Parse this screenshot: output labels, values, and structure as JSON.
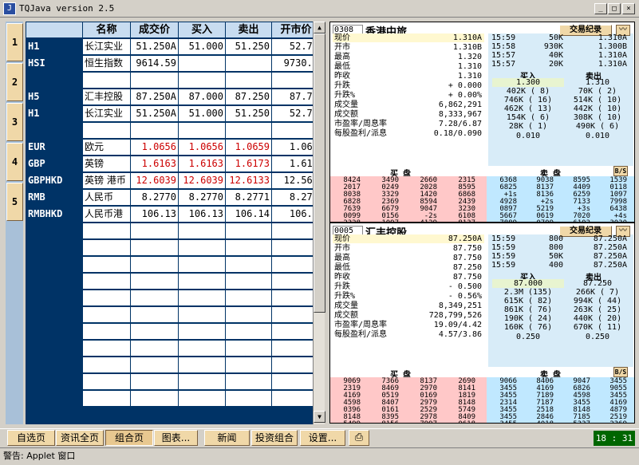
{
  "window": {
    "title": "TQJava version 2.5",
    "icon": "java-cup-icon"
  },
  "side_tabs": [
    "1",
    "2",
    "3",
    "4",
    "5"
  ],
  "grid": {
    "headers": [
      "",
      "名称",
      "成交价",
      "买入",
      "卖出",
      "开市价"
    ],
    "rows": [
      {
        "code": "H1",
        "name": "长江实业",
        "last": "51.250A",
        "bid": "51.000",
        "ask": "51.250",
        "open": "52.75",
        "red": false
      },
      {
        "code": "HSI",
        "name": "恒生指数",
        "last": "9614.59",
        "bid": "",
        "ask": "",
        "open": "9730.5",
        "red": false
      },
      {
        "code": "",
        "name": "",
        "last": "",
        "bid": "",
        "ask": "",
        "open": "",
        "red": false
      },
      {
        "code": "H5",
        "name": "汇丰控股",
        "last": "87.250A",
        "bid": "87.000",
        "ask": "87.250",
        "open": "87.75",
        "red": false
      },
      {
        "code": "H1",
        "name": "长江实业",
        "last": "51.250A",
        "bid": "51.000",
        "ask": "51.250",
        "open": "52.75",
        "red": false
      },
      {
        "code": "",
        "name": "",
        "last": "",
        "bid": "",
        "ask": "",
        "open": "",
        "red": false
      },
      {
        "code": "EUR",
        "name": "欧元",
        "last": "1.0656",
        "bid": "1.0656",
        "ask": "1.0659",
        "open": "1.061",
        "red": true
      },
      {
        "code": "GBP",
        "name": "英镑",
        "last": "1.6163",
        "bid": "1.6163",
        "ask": "1.6173",
        "open": "1.611",
        "red": true
      },
      {
        "code": "GBPHKD",
        "name": "英镑 港币",
        "last": "12.6039",
        "bid": "12.6039",
        "ask": "12.6133",
        "open": "12.561",
        "red": true
      },
      {
        "code": "RMB",
        "name": "人民币",
        "last": "8.2770",
        "bid": "8.2770",
        "ask": "8.2771",
        "open": "8.276",
        "red": false
      },
      {
        "code": "RMBHKD",
        "name": "人民币港",
        "last": "106.13",
        "bid": "106.13",
        "ask": "106.14",
        "open": "106.1",
        "red": false
      }
    ],
    "empty_rows": 11
  },
  "panels": [
    {
      "code": "0308",
      "name": "香港中旅",
      "deal_button": "交易纪录",
      "chart_button": "〰",
      "fields": [
        {
          "label": "现价",
          "value": "1.310A"
        },
        {
          "label": "开市",
          "value": "1.310B"
        },
        {
          "label": "最高",
          "value": "1.320"
        },
        {
          "label": "最低",
          "value": "1.310"
        },
        {
          "label": "昨收",
          "value": "1.310"
        },
        {
          "label": "升跌",
          "value": "+   0.000"
        },
        {
          "label": "升跌%",
          "value": "+   0.00%"
        },
        {
          "label": "成交量",
          "value": "6,862,291"
        },
        {
          "label": "成交额",
          "value": "8,333,967"
        },
        {
          "label": "市盈率/周息率",
          "value": "7.28/6.87"
        },
        {
          "label": "每股盈利/派息",
          "value": "0.18/0.090"
        }
      ],
      "trades": [
        [
          "15:59",
          "50K",
          "1.310A"
        ],
        [
          "15:58",
          "930K",
          "1.300B"
        ],
        [
          "15:57",
          "40K",
          "1.310A"
        ],
        [
          "15:57",
          "20K",
          "1.310A"
        ]
      ],
      "buy_label": "买入",
      "sell_label": "卖出",
      "buy_price": "1.300",
      "sell_price": "1.310",
      "queue": [
        [
          "402K ( 8)",
          "70K ( 2)"
        ],
        [
          "746K ( 16)",
          "514K ( 10)"
        ],
        [
          "462K ( 13)",
          "442K ( 10)"
        ],
        [
          "154K ( 6)",
          "308K ( 10)"
        ],
        [
          "28K ( 1)",
          "490K ( 6)"
        ]
      ],
      "spread": [
        "0.010",
        "0.010"
      ],
      "ob_buy_label": "买 盘",
      "ob_sell_label": "卖 盘",
      "ob_icon": "B/S",
      "ob_buy": [
        [
          "8424",
          "3490",
          "2660",
          "2315"
        ],
        [
          "2017",
          "0249",
          "2028",
          "8595"
        ],
        [
          "8038",
          "3329",
          "1420",
          "6868"
        ],
        [
          "6828",
          "2369",
          "8594",
          "2439"
        ],
        [
          "7639",
          "6679",
          "9047",
          "3230"
        ],
        [
          "0099",
          "0156",
          "-2s",
          "6108"
        ],
        [
          "2328",
          "1097",
          "4129",
          "8137"
        ],
        [
          "5517",
          "0519",
          "0538",
          "6086"
        ],
        [
          "-1s",
          "2369",
          "2515",
          "8394"
        ],
        [
          "0188",
          "6825",
          "2018",
          "-5s"
        ]
      ],
      "ob_sell": [
        [
          "6368",
          "9038",
          "8595",
          "1539"
        ],
        [
          "6825",
          "8137",
          "4409",
          "0118"
        ],
        [
          "+1s",
          "8136",
          "6259",
          "1097"
        ],
        [
          "4928",
          "+2s",
          "7133",
          "7998"
        ],
        [
          "0897",
          "5219",
          "+3s",
          "6438"
        ],
        [
          "5667",
          "0619",
          "7020",
          "+4s"
        ],
        [
          "7889",
          "0709",
          "6102",
          "3030"
        ],
        [
          "1097",
          "2369",
          "6102",
          "5490"
        ],
        [
          "6499",
          "1420",
          "1095",
          "2511"
        ],
        [
          "8408",
          "6086",
          "8529",
          "7889"
        ]
      ]
    },
    {
      "code": "0005",
      "name": "汇丰控股",
      "deal_button": "交易纪录",
      "chart_button": "〰",
      "fields": [
        {
          "label": "现价",
          "value": "87.250A"
        },
        {
          "label": "开市",
          "value": "87.750"
        },
        {
          "label": "最高",
          "value": "87.750"
        },
        {
          "label": "最低",
          "value": "87.250"
        },
        {
          "label": "昨收",
          "value": "87.750"
        },
        {
          "label": "升跌",
          "value": "-   0.500"
        },
        {
          "label": "升跌%",
          "value": "-   0.56%"
        },
        {
          "label": "成交量",
          "value": "8,349,251"
        },
        {
          "label": "成交额",
          "value": "728,799,526"
        },
        {
          "label": "市盈率/周息率",
          "value": "19.09/4.42"
        },
        {
          "label": "每股盈利/派息",
          "value": "4.57/3.86"
        }
      ],
      "trades": [
        [
          "15:59",
          "800",
          "87.250A"
        ],
        [
          "15:59",
          "800",
          "87.250A"
        ],
        [
          "15:59",
          "50K",
          "87.250A"
        ],
        [
          "15:59",
          "400",
          "87.250A"
        ]
      ],
      "buy_label": "买入",
      "sell_label": "卖出",
      "buy_price": "87.000",
      "sell_price": "87.250",
      "queue": [
        [
          "2.3M (135)",
          "266K ( 7)"
        ],
        [
          "615K ( 82)",
          "994K ( 44)"
        ],
        [
          "861K ( 76)",
          "263K ( 25)"
        ],
        [
          "190K ( 24)",
          "440K ( 20)"
        ],
        [
          "160K ( 76)",
          "670K ( 11)"
        ]
      ],
      "spread": [
        "0.250",
        "0.250"
      ],
      "ob_buy_label": "买 盘",
      "ob_sell_label": "卖 盘",
      "ob_icon": "B/S",
      "ob_buy": [
        [
          "9069",
          "7366",
          "8137",
          "2690"
        ],
        [
          "2319",
          "8469",
          "2970",
          "8141"
        ],
        [
          "4169",
          "0519",
          "0169",
          "1819"
        ],
        [
          "4598",
          "8407",
          "2979",
          "8148"
        ],
        [
          "0396",
          "0161",
          "2529",
          "5749"
        ],
        [
          "8148",
          "8395",
          "2978",
          "8409"
        ],
        [
          "5499",
          "8156",
          "7997",
          "0618"
        ],
        [
          "6999",
          "2518",
          "3178",
          "2369"
        ],
        [
          "8148",
          "8409",
          "3179",
          "5161"
        ],
        [
          "6459",
          "2518",
          "8595",
          "8148"
        ]
      ],
      "ob_sell": [
        [
          "9066",
          "8406",
          "9047",
          "3455"
        ],
        [
          "3455",
          "4169",
          "6826",
          "9055"
        ],
        [
          "3455",
          "7189",
          "4598",
          "3455"
        ],
        [
          "2314",
          "7187",
          "3455",
          "4169"
        ],
        [
          "3455",
          "2518",
          "8148",
          "4879"
        ],
        [
          "3455",
          "2846",
          "7185",
          "2519"
        ],
        [
          "3455",
          "4018",
          "5337",
          "2369"
        ],
        [
          "+1s",
          "8408",
          "7929",
          "4169"
        ],
        [
          "8519",
          "4596",
          "2457",
          "2519"
        ],
        [
          "7137",
          "8594",
          "4169",
          "8148"
        ]
      ]
    }
  ],
  "nav": [
    "自选页",
    "资讯全页",
    "组合页",
    "图表...",
    "新闻",
    "投资组合",
    "设置..."
  ],
  "nav_active": "组合页",
  "print_icon": "printer-icon",
  "clock": "18 : 31",
  "status": "警告: Applet 窗口",
  "colors": {
    "grid_bg": "#003366",
    "cell_bg": "#ffffff",
    "red": "#cc0000",
    "tab_bg": "#f0d8a8",
    "clock_bg": "#006600"
  }
}
